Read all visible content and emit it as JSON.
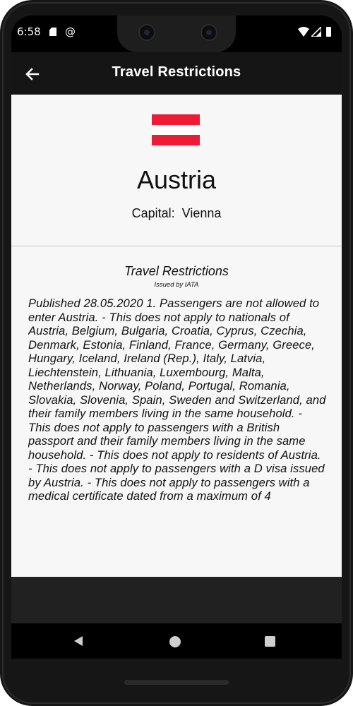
{
  "status_bar": {
    "time": "6:58",
    "icons": [
      "sd-card-icon",
      "at-sign-icon",
      "wifi-icon",
      "signal-icon",
      "battery-icon"
    ]
  },
  "app_bar": {
    "title": "Travel Restrictions",
    "back_icon": "arrow-left-icon"
  },
  "country": {
    "name": "Austria",
    "capital_label": "Capital:",
    "capital_value": "Vienna",
    "flag": {
      "colors": [
        "#ef1a35",
        "#ffffff",
        "#ef1a35"
      ]
    }
  },
  "restrictions": {
    "title": "Travel Restrictions",
    "source": "Issued by IATA",
    "text": "Published 28.05.2020 1. Passengers are not allowed to enter Austria.  - This does not apply to nationals of Austria, Belgium, Bulgaria, Croatia, Cyprus, Czechia, Denmark, Estonia, Finland, France, Germany, Greece, Hungary, Iceland, Ireland (Rep.), Italy, Latvia, Liechtenstein, Lithuania, Luxembourg, Malta, Netherlands, Norway, Poland, Portugal, Romania, Slovakia, Slovenia, Spain, Sweden and Switzerland, and their family members living in the same household. - This does not apply to passengers with a British passport and their family members living in the same household. - This does not apply to residents of Austria.  - This does not apply to passengers with a D visa issued by Austria.  - This does not apply to passengers with a medical certificate dated from a maximum of 4"
  },
  "nav_bar": {
    "icons": [
      "nav-back-icon",
      "nav-home-icon",
      "nav-recents-icon"
    ]
  },
  "colors": {
    "app_bar": "#151515",
    "content_bg": "#f7f7f7",
    "flag_red": "#ef1a35"
  }
}
